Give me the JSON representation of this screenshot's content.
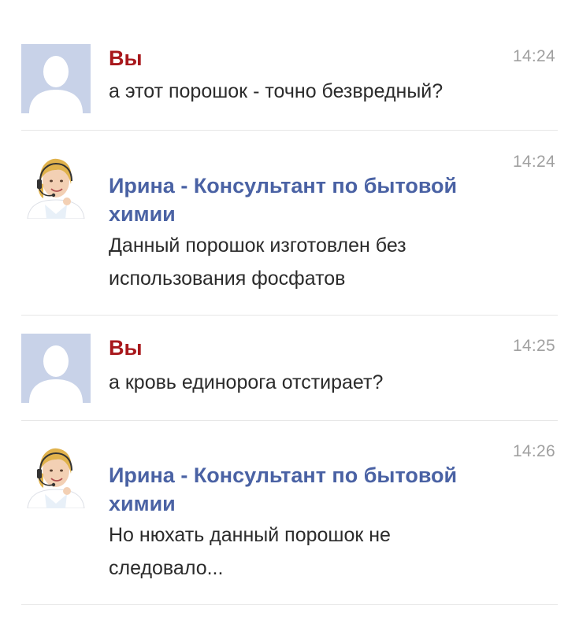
{
  "messages": [
    {
      "sender": "Вы",
      "role": "you",
      "time": "14:24",
      "text": "а этот порошок - точно безвредный?"
    },
    {
      "sender": "Ирина - Консультант по бытовой",
      "sender2": "химии",
      "role": "agent",
      "time": "14:24",
      "text": "Данный порошок изготовлен без",
      "text2": "использования фосфатов"
    },
    {
      "sender": "Вы",
      "role": "you",
      "time": "14:25",
      "text": "а кровь единорога отстирает?"
    },
    {
      "sender": "Ирина - Консультант по бытовой",
      "sender2": "химии",
      "role": "agent",
      "time": "14:26",
      "text": "Но нюхать данный порошок не",
      "text2": "следовало..."
    }
  ],
  "colors": {
    "you_name": "#a8181c",
    "agent_name": "#4a62a4",
    "time": "#a0a0a0",
    "placeholder_avatar": "#c8d2e8"
  },
  "icons": {
    "you_avatar": "user-placeholder-icon",
    "agent_avatar": "consultant-headset-avatar"
  }
}
